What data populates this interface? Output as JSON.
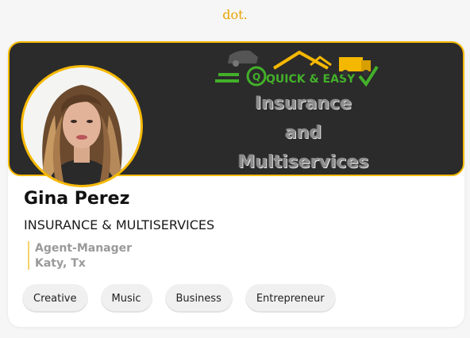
{
  "header": {
    "logo_text": "dot."
  },
  "profile": {
    "banner": {
      "logo_text": "QUICK & EASY",
      "line1": "Insurance",
      "line2": "and",
      "line3": "Multiservices"
    },
    "name": "Gina Perez",
    "company": "INSURANCE & MULTISERVICES",
    "title": "Agent-Manager",
    "location": "Katy, Tx",
    "tags": [
      "Creative",
      "Music",
      "Business",
      "Entrepreneur"
    ]
  },
  "colors": {
    "accent": "#f5b800",
    "banner_bg": "#2b2b2b",
    "logo": "#e8a400",
    "qe_green": "#43b02a"
  }
}
